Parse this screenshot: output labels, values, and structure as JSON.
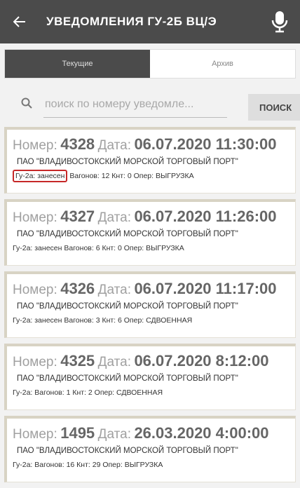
{
  "app_bar": {
    "title": "УВЕДОМЛЕНИЯ ГУ-2Б ВЦ/Э",
    "back_icon": "arrow-left-icon",
    "mic_icon": "microphone-icon"
  },
  "tabs": [
    {
      "label": "Текущие",
      "active": true
    },
    {
      "label": "Архив",
      "active": false
    }
  ],
  "search": {
    "placeholder": "поиск по номеру уведомле...",
    "button_label": "ПОИСК"
  },
  "labels": {
    "number": "Номер:",
    "date": "Дата:"
  },
  "notifications": [
    {
      "number": "4328",
      "date": "06.07.2020 11:30:00",
      "org": "ПАО \"ВЛАДИВОСТОКСКИЙ МОРСКОЙ ТОРГОВЫЙ ПОРТ\"",
      "gu": "Гу-2а: занесен",
      "details": "Вагонов: 12 Кнт: 0 Опер: ВЫГРУЗКА"
    },
    {
      "number": "4327",
      "date": "06.07.2020 11:26:00",
      "org": "ПАО \"ВЛАДИВОСТОКСКИЙ МОРСКОЙ ТОРГОВЫЙ ПОРТ\"",
      "gu": "Гу-2а: занесен",
      "details": "Вагонов: 6 Кнт: 0 Опер: ВЫГРУЗКА"
    },
    {
      "number": "4326",
      "date": "06.07.2020 11:17:00",
      "org": "ПАО \"ВЛАДИВОСТОКСКИЙ МОРСКОЙ ТОРГОВЫЙ ПОРТ\"",
      "gu": "Гу-2а: занесен",
      "details": "Вагонов: 3 Кнт: 6 Опер: СДВОЕННАЯ"
    },
    {
      "number": "4325",
      "date": "06.07.2020 8:12:00",
      "org": "ПАО \"ВЛАДИВОСТОКСКИЙ МОРСКОЙ ТОРГОВЫЙ ПОРТ\"",
      "gu": "Гу-2а:",
      "details": "Вагонов: 1 Кнт: 2 Опер: СДВОЕННАЯ"
    },
    {
      "number": "1495",
      "date": "26.03.2020 4:00:00",
      "org": "ПАО \"ВЛАДИВОСТОКСКИЙ МОРСКОЙ ТОРГОВЫЙ ПОРТ\"",
      "gu": "Гу-2а:",
      "details": "Вагонов: 16 Кнт: 29 Опер: ВЫГРУЗКА"
    }
  ],
  "colors": {
    "app_bar": "#4b4b4b",
    "card_border": "#d8d3c4",
    "highlight": "#c62828"
  }
}
